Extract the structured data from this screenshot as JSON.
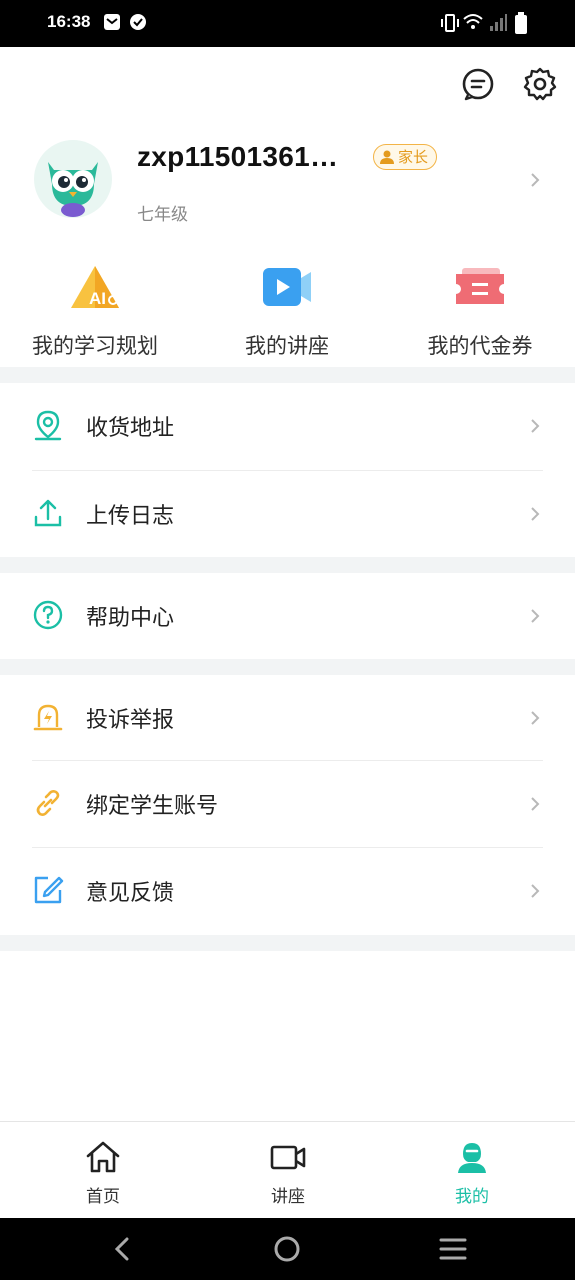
{
  "status_bar": {
    "time": "16:38"
  },
  "header": {
    "message_icon": "chat-bubble-icon",
    "settings_icon": "gear-icon"
  },
  "profile": {
    "username": "zxp11501361…",
    "role_badge": "家长",
    "grade": "七年级"
  },
  "quick_actions": [
    {
      "label": "我的学习规划",
      "icon": "ai-plan-icon"
    },
    {
      "label": "我的讲座",
      "icon": "video-play-icon"
    },
    {
      "label": "我的代金券",
      "icon": "coupon-icon"
    }
  ],
  "menu_groups": [
    [
      {
        "label": "收货地址",
        "icon": "location-pin-icon"
      },
      {
        "label": "上传日志",
        "icon": "upload-icon"
      }
    ],
    [
      {
        "label": "帮助中心",
        "icon": "help-circle-icon"
      }
    ],
    [
      {
        "label": "投诉举报",
        "icon": "alarm-icon"
      },
      {
        "label": "绑定学生账号",
        "icon": "link-icon"
      },
      {
        "label": "意见反馈",
        "icon": "edit-icon"
      }
    ]
  ],
  "bottom_nav": [
    {
      "label": "首页",
      "icon": "home-icon",
      "active": false
    },
    {
      "label": "讲座",
      "icon": "video-camera-icon",
      "active": false
    },
    {
      "label": "我的",
      "icon": "person-icon",
      "active": true
    }
  ],
  "colors": {
    "accent": "#1bbfa6",
    "badge": "#e49b1e",
    "separator": "#f2f4f5"
  }
}
